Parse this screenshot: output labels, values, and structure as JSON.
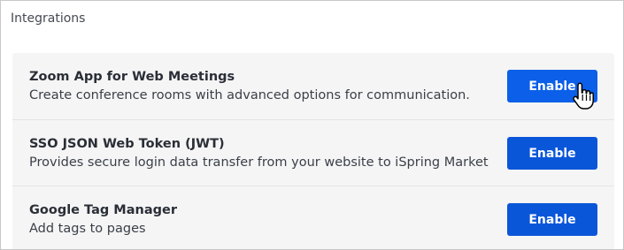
{
  "section": {
    "title": "Integrations"
  },
  "integrations": [
    {
      "title": "Zoom App for Web Meetings",
      "description": "Create conference rooms with advanced options for communication.",
      "button_label": "Enable"
    },
    {
      "title": "SSO JSON Web Token (JWT)",
      "description": "Provides secure login data transfer from your website to iSpring Market",
      "button_label": "Enable"
    },
    {
      "title": "Google Tag Manager",
      "description": "Add tags to pages",
      "button_label": "Enable"
    }
  ],
  "colors": {
    "button": "#0a56d9",
    "row_background": "#f5f5f6",
    "title_text": "#2a2e36"
  },
  "icons": {
    "cursor": "hand-pointer-icon"
  }
}
